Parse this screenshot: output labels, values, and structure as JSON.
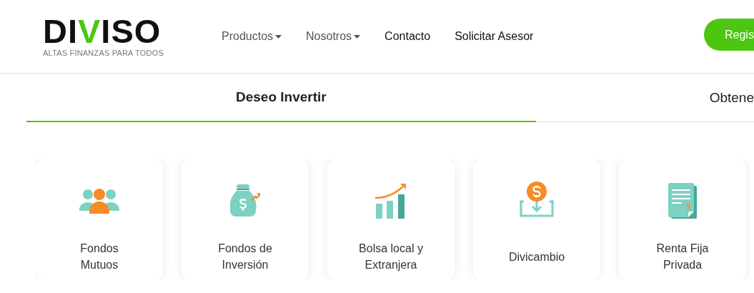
{
  "logo": {
    "before": "DI",
    "accent": "V",
    "after": "ISO",
    "tagline": "ALTAS FINANZAS PARA TODOS"
  },
  "nav": [
    {
      "label": "Productos",
      "kind": "dropdown"
    },
    {
      "label": "Nosotros",
      "kind": "dropdown"
    },
    {
      "label": "Contacto",
      "kind": "link"
    },
    {
      "label": "Solicitar Asesor",
      "kind": "link"
    }
  ],
  "register_button": "Regis",
  "tabs": [
    {
      "label": "Deseo Invertir",
      "selected": true
    },
    {
      "label": "Obtene",
      "selected": false
    }
  ],
  "products": [
    {
      "label": "Fondos Mutuos",
      "kind": "people"
    },
    {
      "label": "Fondos de Inversión",
      "kind": "moneybag"
    },
    {
      "label": "Bolsa local y Extranjera",
      "kind": "chart"
    },
    {
      "label": "Divicambio",
      "kind": "exchange"
    },
    {
      "label": "Renta Fija Privada",
      "kind": "document"
    }
  ]
}
